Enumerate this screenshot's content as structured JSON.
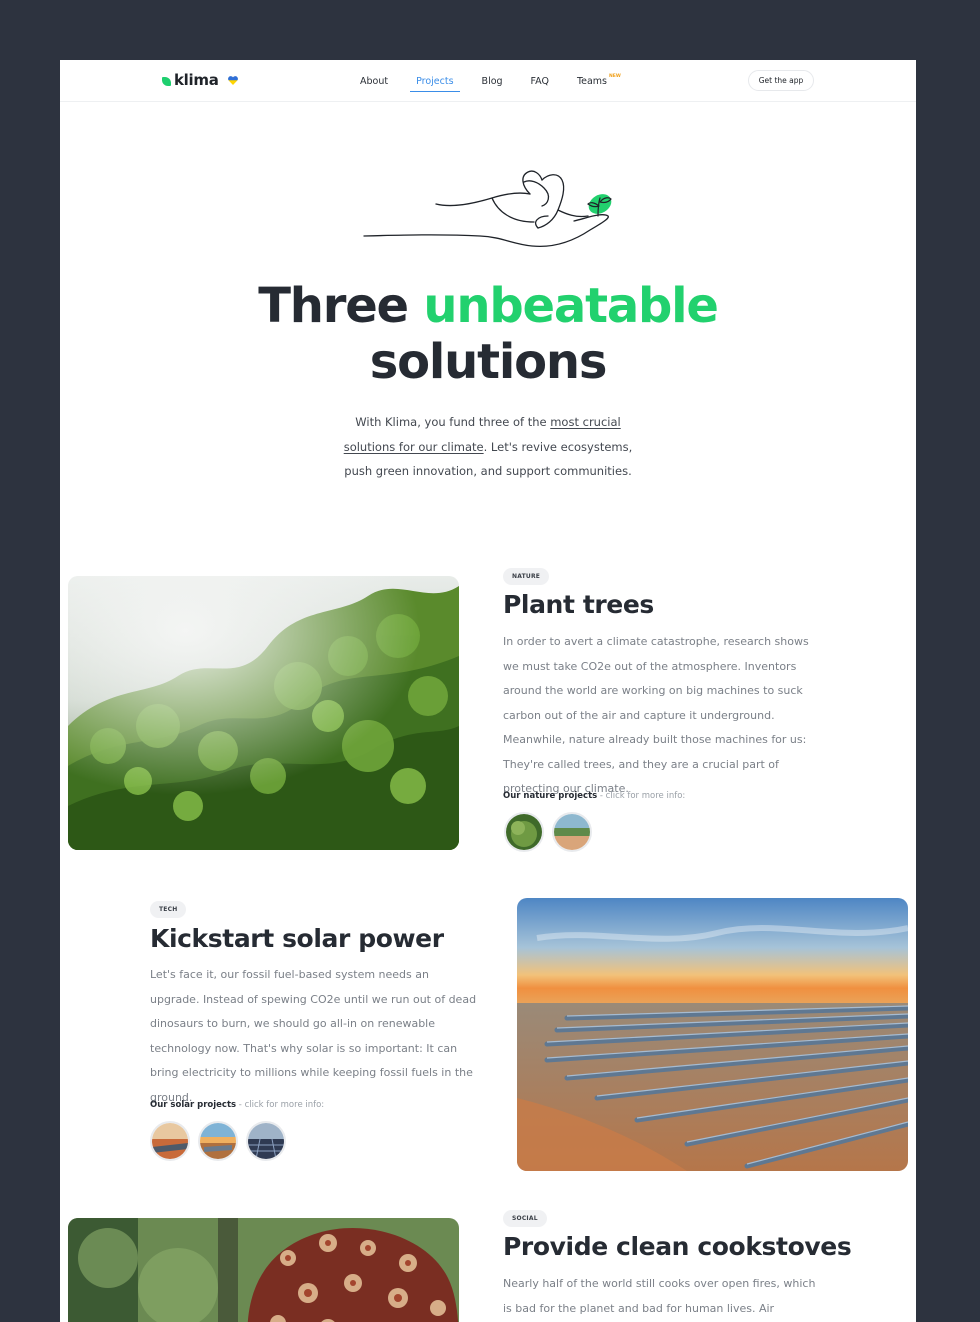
{
  "brand": {
    "name": "klima"
  },
  "nav": {
    "links": [
      {
        "label": "About"
      },
      {
        "label": "Projects"
      },
      {
        "label": "Blog"
      },
      {
        "label": "FAQ"
      },
      {
        "label": "Teams",
        "badge": "NEW"
      }
    ],
    "active_index": 1,
    "cta_label": "Get the app"
  },
  "hero": {
    "title_part1": "Three",
    "title_highlight": "unbeatable",
    "title_part2": "solutions",
    "lead_prefix": "With Klima, you fund three of the",
    "lead_link": "most crucial solutions for our climate",
    "lead_suffix": ". Let's revive ecosystems, push green innovation, and support communities."
  },
  "sections": [
    {
      "tag": "NATURE",
      "title": "Plant trees",
      "body": "In order to avert a climate catastrophe, research shows we must take CO2e out of the atmosphere. Inventors around the world are working on big machines to suck carbon out of the air and capture it underground. Meanwhile, nature already built those machines for us: They're called trees, and they are a crucial part of protecting our climate.",
      "projects_label": "Our nature projects",
      "projects_hint": "- click for more info:"
    },
    {
      "tag": "TECH",
      "title": "Kickstart solar power",
      "body": "Let's face it, our fossil fuel-based system needs an upgrade. Instead of spewing CO2e until we run out of dead dinosaurs to burn, we should go all-in on renewable technology now. That's why solar is so important: It can bring electricity to millions while keeping fossil fuels in the ground.",
      "projects_label": "Our solar projects",
      "projects_hint": "- click for more info:"
    },
    {
      "tag": "SOCIAL",
      "title": "Provide clean cookstoves",
      "body": "Nearly half of the world still cooks over open fires, which is bad for the planet and bad for human lives. Air pollution"
    }
  ],
  "colors": {
    "accent_green": "#22d16e",
    "link_blue": "#3a8de8",
    "backdrop": "#2d333f",
    "badge_orange": "#f0a11c"
  }
}
